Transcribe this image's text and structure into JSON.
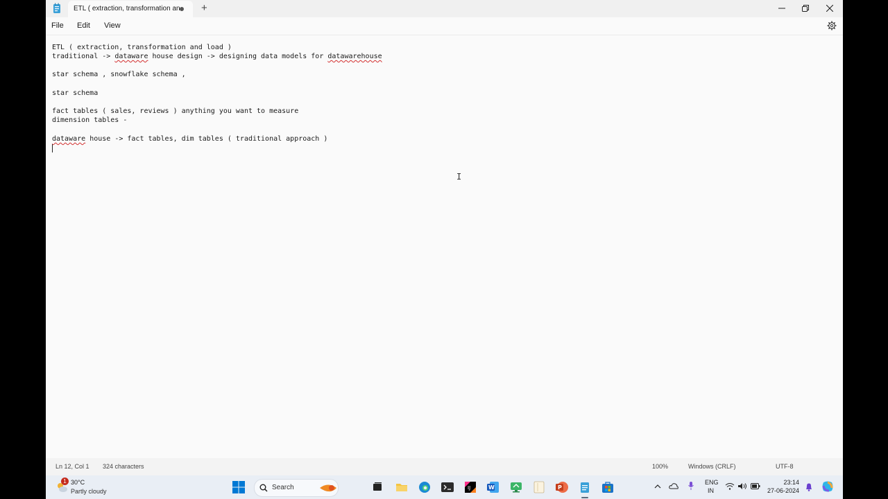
{
  "window": {
    "tab_title": "ETL ( extraction, transformation an",
    "new_tab_symbol": "+",
    "minimize_symbol": "–",
    "maximize_symbol": "❐",
    "close_symbol": "✕"
  },
  "menu": {
    "file": "File",
    "edit": "Edit",
    "view": "View"
  },
  "editor": {
    "lines": [
      "ETL ( extraction, transformation and load )",
      "traditional -> dataware house design -> designing data models for datawarehouse",
      "",
      "star schema , snowflake schema ,",
      "",
      "star schema",
      "",
      "fact tables ( sales, reviews ) anything you want to measure",
      "dimension tables -",
      "",
      "dataware house -> fact tables, dim tables ( traditional approach )",
      ""
    ],
    "line2_part1": "traditional -> ",
    "line2_misspelled1": "dataware",
    "line2_part2": " house design -> designing data models for ",
    "line2_misspelled2": "datawarehouse",
    "line11_misspelled": "dataware",
    "line11_rest": " house -> fact tables, dim tables ( traditional approach )"
  },
  "status": {
    "position": "Ln 12, Col 1",
    "characters": "324 characters",
    "zoom": "100%",
    "line_ending": "Windows (CRLF)",
    "encoding": "UTF-8"
  },
  "taskbar": {
    "weather_temp": "30°C",
    "weather_desc": "Partly cloudy",
    "weather_badge": "1",
    "search_label": "Search",
    "lang": "ENG",
    "region": "IN",
    "time": "23:14",
    "date": "27-06-2024"
  },
  "colors": {
    "misspell_underline": "#d32f2f",
    "windows_blue": "#0078d4"
  }
}
